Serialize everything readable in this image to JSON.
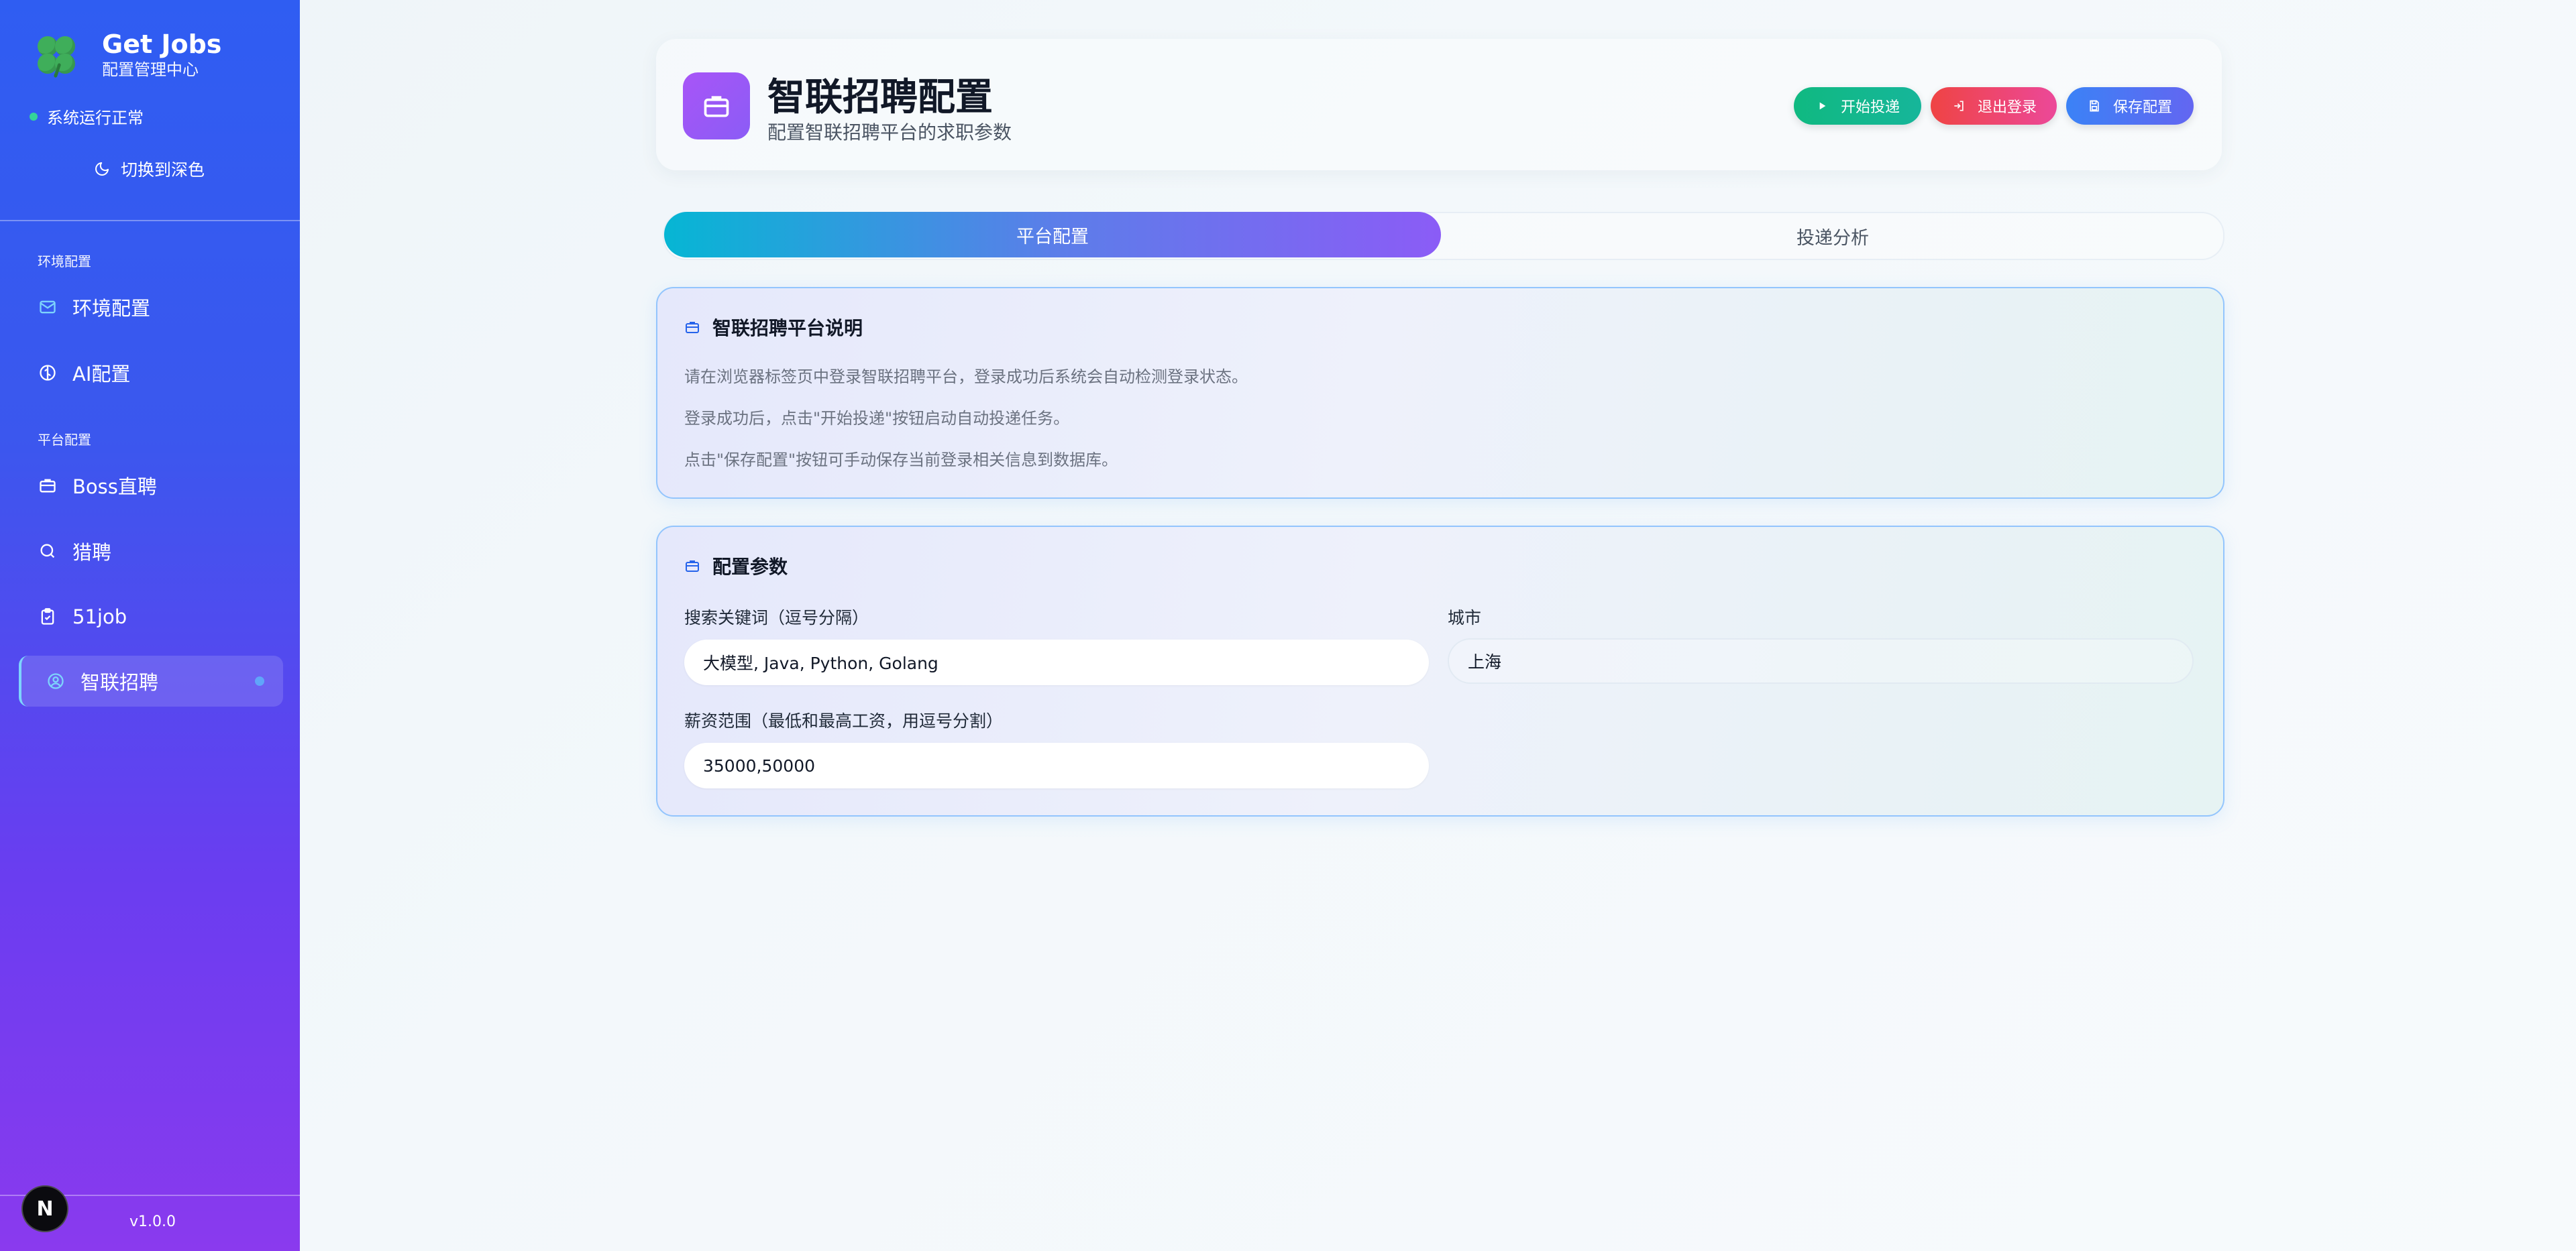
{
  "app": {
    "title": "Get Jobs",
    "subtitle": "配置管理中心",
    "status": "系统运行正常",
    "theme_toggle": "切换到深色",
    "version": "v1.0.0",
    "badge": "N"
  },
  "sidebar": {
    "groups": [
      {
        "label": "环境配置"
      },
      {
        "label": "平台配置"
      }
    ],
    "items": [
      {
        "label": "环境配置",
        "icon": "mail-icon"
      },
      {
        "label": "AI配置",
        "icon": "brain-icon"
      },
      {
        "label": "Boss直聘",
        "icon": "briefcase-icon"
      },
      {
        "label": "猎聘",
        "icon": "search-icon"
      },
      {
        "label": "51job",
        "icon": "clipboard-icon"
      },
      {
        "label": "智联招聘",
        "icon": "user-circle-icon",
        "active": true
      }
    ]
  },
  "header": {
    "title": "智联招聘配置",
    "subtitle": "配置智联招聘平台的求职参数",
    "buttons": {
      "start": "开始投递",
      "logout": "退出登录",
      "save": "保存配置"
    }
  },
  "tabs": [
    {
      "label": "平台配置",
      "active": true
    },
    {
      "label": "投递分析",
      "active": false
    }
  ],
  "info_card": {
    "title": "智联招聘平台说明",
    "lines": [
      "请在浏览器标签页中登录智联招聘平台，登录成功后系统会自动检测登录状态。",
      "登录成功后，点击\"开始投递\"按钮启动自动投递任务。",
      "点击\"保存配置\"按钮可手动保存当前登录相关信息到数据库。"
    ]
  },
  "config_card": {
    "title": "配置参数",
    "keywords": {
      "label": "搜索关键词（逗号分隔）",
      "value": "大模型, Java, Python, Golang"
    },
    "city": {
      "label": "城市",
      "value": "上海"
    },
    "salary": {
      "label": "薪资范围（最低和最高工资，用逗号分割）",
      "value": "35000,50000"
    }
  },
  "colors": {
    "sidebar_top": "#2f5df2",
    "sidebar_bottom": "#8a3aee",
    "start_button": "#10b981",
    "logout_button": "#ef4444",
    "save_button": "#3b82f6",
    "card_border": "#93c5fd"
  }
}
